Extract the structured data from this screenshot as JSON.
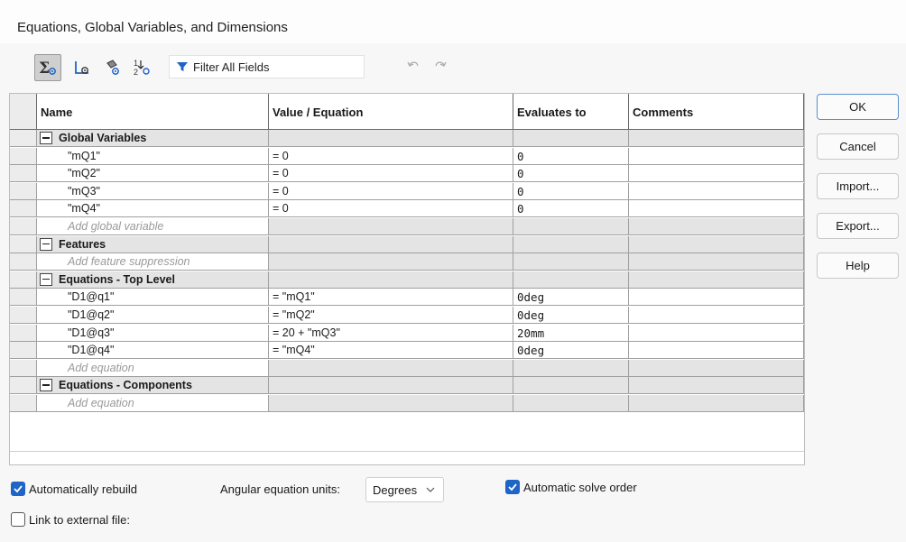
{
  "window": {
    "title": "Equations, Global Variables, and Dimensions"
  },
  "toolbar": {
    "buttons": [
      {
        "icon": "equation-view-icon",
        "active": true
      },
      {
        "icon": "sketch-equation-view-icon",
        "active": false
      },
      {
        "icon": "dimension-view-icon",
        "active": false
      },
      {
        "icon": "ordered-view-icon",
        "active": false
      }
    ],
    "filter_label": "Filter All Fields",
    "undo_icon": "undo-icon",
    "redo_icon": "redo-icon"
  },
  "table": {
    "columns": [
      "Name",
      "Value / Equation",
      "Evaluates to",
      "Comments"
    ],
    "rows": [
      {
        "kind": "section",
        "name": "Global Variables",
        "value": "",
        "eval": "",
        "comment": ""
      },
      {
        "kind": "data",
        "name": "\"mQ1\"",
        "value": "= 0",
        "eval": "0",
        "comment": ""
      },
      {
        "kind": "data",
        "name": "\"mQ2\"",
        "value": "= 0",
        "eval": "0",
        "comment": ""
      },
      {
        "kind": "data",
        "name": "\"mQ3\"",
        "value": "= 0",
        "eval": "0",
        "comment": ""
      },
      {
        "kind": "data",
        "name": "\"mQ4\"",
        "value": "= 0",
        "eval": "0",
        "comment": ""
      },
      {
        "kind": "add",
        "name": "Add global variable"
      },
      {
        "kind": "section",
        "name": "Features"
      },
      {
        "kind": "add",
        "name": "Add feature suppression"
      },
      {
        "kind": "section",
        "name": "Equations - Top Level"
      },
      {
        "kind": "data",
        "name": "\"D1@q1\"",
        "value": "= \"mQ1\"",
        "eval": "0deg",
        "comment": ""
      },
      {
        "kind": "data",
        "name": "\"D1@q2\"",
        "value": "= \"mQ2\"",
        "eval": "0deg",
        "comment": ""
      },
      {
        "kind": "data",
        "name": "\"D1@q3\"",
        "value": "= 20 + \"mQ3\"",
        "eval": "20mm",
        "comment": ""
      },
      {
        "kind": "data",
        "name": "\"D1@q4\"",
        "value": "= \"mQ4\"",
        "eval": "0deg",
        "comment": ""
      },
      {
        "kind": "add",
        "name": "Add equation"
      },
      {
        "kind": "section",
        "name": "Equations - Components"
      },
      {
        "kind": "add",
        "name": "Add equation"
      }
    ]
  },
  "side_buttons": [
    "OK",
    "Cancel",
    "Import...",
    "Export...",
    "Help"
  ],
  "options": {
    "auto_rebuild": {
      "label": "Automatically rebuild",
      "checked": true
    },
    "angular_units_label": "Angular equation units:",
    "angular_units_value": "Degrees",
    "auto_solve": {
      "label": "Automatic solve order",
      "checked": true
    },
    "link_external": {
      "label": "Link to external file:",
      "checked": false
    }
  },
  "colors": {
    "accent": "#1f64c7",
    "section_gray": "#e4e4e4"
  }
}
